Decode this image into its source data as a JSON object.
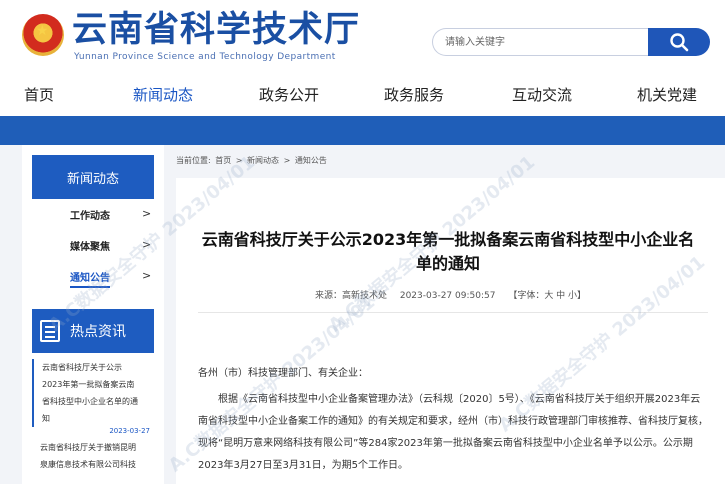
{
  "header": {
    "title": "云南省科学技术厅",
    "subtitle": "Yunnan Province Science and Technology Department"
  },
  "search": {
    "placeholder": "请输入关键字"
  },
  "nav": {
    "items": [
      "首页",
      "新闻动态",
      "政务公开",
      "政务服务",
      "互动交流",
      "机关党建"
    ],
    "active": "新闻动态"
  },
  "breadcrumb": {
    "prefix": "当前位置:",
    "items": [
      "首页",
      ">",
      "新闻动态",
      ">",
      "通知公告"
    ]
  },
  "sidebar": {
    "heading": "新闻动态",
    "items": [
      {
        "label": "工作动态",
        "chevron": ">"
      },
      {
        "label": "媒体聚焦",
        "chevron": ">"
      },
      {
        "label": "通知公告",
        "chevron": ">"
      }
    ],
    "hot_heading": "热点资讯",
    "hot": [
      {
        "lines": [
          "云南省科技厅关于公示",
          "2023年第一批拟备案云南",
          "省科技型中小企业名单的通",
          "知"
        ],
        "date": "2023-03-27"
      },
      {
        "lines": [
          "云南省科技厅关于撤销昆明",
          "泉康信息技术有限公司科技"
        ],
        "date": ""
      }
    ]
  },
  "article": {
    "title": "云南省科技厅关于公示2023年第一批拟备案云南省科技型中小企业名单的通知",
    "source": "来源：高新技术处",
    "datetime": "2023-03-27 09:50:57",
    "font_label": "【字体：大 中 小】",
    "salutation": "各州（市）科技管理部门、有关企业：",
    "body": "根据《云南省科技型中小企业备案管理办法》（云科规〔2020〕5号）、《云南省科技厅关于组织开展2023年云南省科技型中小企业备案工作的通知》的有关规定和要求，经州（市）科技行政管理部门审核推荐、省科技厅复核，现将“昆明万意来网络科技有限公司”等284家2023年第一批拟备案云南省科技型中小企业名单予以公示。公示期2023年3月27日至3月31日，为期5个工作日。"
  },
  "watermark": "A.C数据安全守护 2023/04/01",
  "colors": {
    "brand_blue": "#1f56b8",
    "band_blue": "#1f5eb8",
    "active_link": "#1a56c4"
  }
}
